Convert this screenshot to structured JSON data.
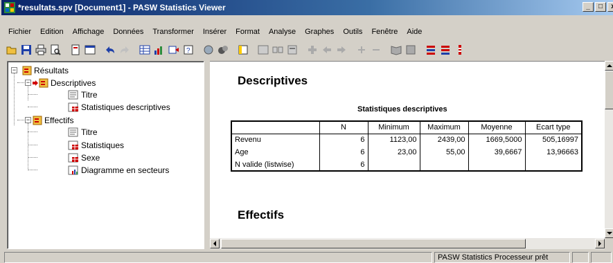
{
  "window": {
    "title": "*resultats.spv [Document1] - PASW Statistics Viewer",
    "controls": {
      "minimize": "_",
      "maximize": "□",
      "close": "x"
    }
  },
  "menubar": {
    "items": [
      "Fichier",
      "Edition",
      "Affichage",
      "Données",
      "Transformer",
      "Insérer",
      "Format",
      "Analyse",
      "Graphes",
      "Outils",
      "Fenêtre",
      "Aide"
    ]
  },
  "toolbar": {
    "icons": [
      "open-icon",
      "save-icon",
      "print-icon",
      "print-preview-icon",
      "export-icon",
      "recall-dialog-icon",
      "undo-icon",
      "redo-icon",
      "goto-data-icon",
      "goto-case-icon",
      "goto-variable-icon",
      "variables-icon",
      "select-cases-icon",
      "value-labels-icon",
      "split-file-icon",
      "designate-window-icon",
      "insert-heading-icon",
      "insert-title-icon",
      "insert-text-icon",
      "promote-icon",
      "back-icon",
      "forward-icon",
      "expand-icon",
      "collapse-icon",
      "show-icon",
      "hide-icon",
      "pivot-icon",
      "go-to-output-icon",
      "weight-icon"
    ]
  },
  "outline": {
    "root": "Résultats",
    "descriptives": "Descriptives",
    "titre1": "Titre",
    "stats_descr": "Statistiques descriptives",
    "effectifs": "Effectifs",
    "titre2": "Titre",
    "statistiques": "Statistiques",
    "sexe": "Sexe",
    "diagramme": "Diagramme en secteurs",
    "expand_minus": "−"
  },
  "viewer": {
    "heading_descriptives": "Descriptives",
    "table_title": "Statistiques descriptives",
    "columns": [
      "",
      "N",
      "Minimum",
      "Maximum",
      "Moyenne",
      "Ecart type"
    ],
    "rows": [
      [
        "Revenu",
        "6",
        "1123,00",
        "2439,00",
        "1669,5000",
        "505,16997"
      ],
      [
        "Age",
        "6",
        "23,00",
        "55,00",
        "39,6667",
        "13,96663"
      ],
      [
        "N valide (listwise)",
        "6",
        "",
        "",
        "",
        ""
      ]
    ],
    "heading_effectifs": "Effectifs"
  },
  "statusbar": {
    "message": "PASW Statistics  Processeur prêt"
  },
  "colors": {
    "titlebar_start": "#0a246a",
    "titlebar_end": "#a6caf0",
    "chrome": "#d4d0c8",
    "book_icon": "#e0a000",
    "arrow_red": "#d00000"
  }
}
